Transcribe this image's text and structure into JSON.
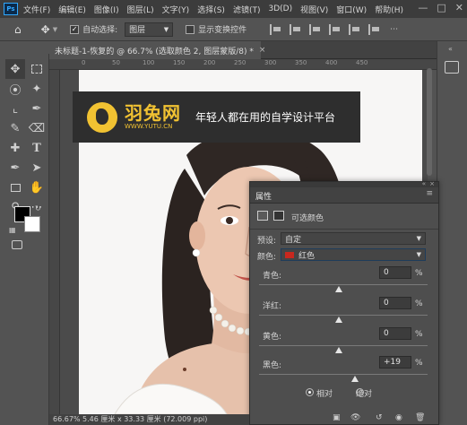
{
  "app": {
    "logo": "Ps"
  },
  "menu": [
    "文件(F)",
    "编辑(E)",
    "图像(I)",
    "图层(L)",
    "文字(Y)",
    "选择(S)",
    "滤镜(T)",
    "3D(D)",
    "视图(V)",
    "窗口(W)",
    "帮助(H)"
  ],
  "window_controls": [
    "minimize-icon",
    "maximize-icon",
    "close-icon"
  ],
  "options": {
    "auto_select_label": "自动选择:",
    "auto_select_checked": true,
    "auto_select_value": "图层",
    "show_transform_label": "显示变换控件",
    "show_transform_checked": false
  },
  "document_tab": {
    "title": "未标题-1-恢复的 @ 66.7% (选取颜色 2, 图层蒙版/8) *"
  },
  "ruler_h": [
    "0",
    "50",
    "100",
    "150",
    "200",
    "250",
    "300",
    "350",
    "400",
    "450"
  ],
  "banner": {
    "brand_cn": "羽兔网",
    "brand_url": "WWW.YUTU.CN",
    "slogan": "年轻人都在用的自学设计平台"
  },
  "properties": {
    "title": "属性",
    "adjustment_name": "可选颜色",
    "preset_label": "预设:",
    "preset_value": "自定",
    "colors_label": "颜色:",
    "colors_value": "红色",
    "colors_swatch": "#c8281e",
    "sliders": [
      {
        "label": "青色:",
        "value": "0",
        "unit": "%",
        "level": 0
      },
      {
        "label": "洋红:",
        "value": "0",
        "unit": "%",
        "level": 0
      },
      {
        "label": "黄色:",
        "value": "0",
        "unit": "%",
        "level": 0
      },
      {
        "label": "黑色:",
        "value": "+19",
        "unit": "%",
        "level": 19
      }
    ],
    "method": {
      "relative": "相对",
      "absolute": "绝对",
      "selected": "relative"
    }
  },
  "status_bar": {
    "text": "66.67%  5.46 厘米 x 33.33 厘米 (72.009 ppi)"
  },
  "colors": {
    "foreground": "#000000",
    "background": "#ffffff",
    "accent": "#31a8ff"
  }
}
